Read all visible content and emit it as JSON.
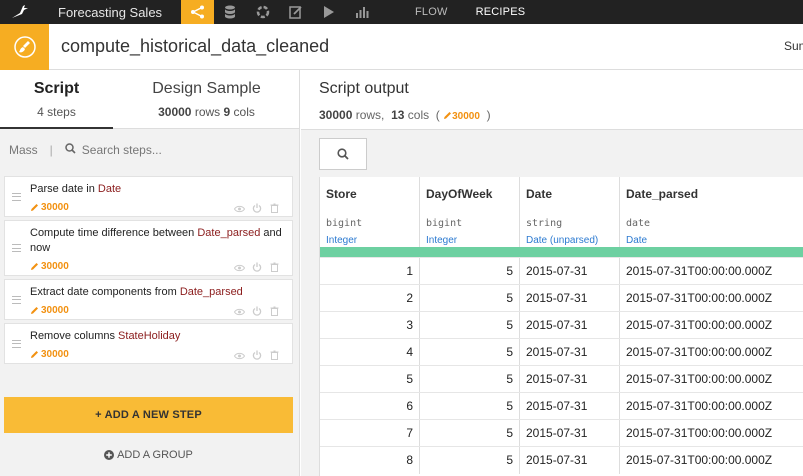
{
  "nav": {
    "project": "Forecasting Sales",
    "links": [
      "FLOW",
      "RECIPES"
    ]
  },
  "header": {
    "title": "compute_historical_data_cleaned",
    "right_text": "Sum"
  },
  "left": {
    "tabs": {
      "script": {
        "label": "Script",
        "sub_count": "4",
        "sub_label": "steps"
      },
      "design": {
        "label": "Design Sample",
        "rows": "30000",
        "rows_label": "rows",
        "cols": "9",
        "cols_label": "cols"
      }
    },
    "search": {
      "mass": "Mass",
      "placeholder": "Search steps..."
    },
    "steps": [
      {
        "text": "Parse date",
        "connector": "in",
        "column": "Date",
        "tail": "",
        "count": "30000"
      },
      {
        "text": "Compute time difference",
        "connector": "between",
        "column": "Date_parsed",
        "tail": "and now",
        "count": "30000"
      },
      {
        "text": "Extract date components",
        "connector": "from",
        "column": "Date_parsed",
        "tail": "",
        "count": "30000"
      },
      {
        "text": "Remove columns",
        "connector": "",
        "column": "StateHoliday",
        "tail": "",
        "count": "30000"
      }
    ],
    "add_step": "+ ADD A NEW STEP",
    "add_group": "ADD A GROUP"
  },
  "right": {
    "title": "Script output",
    "rows": "30000",
    "rows_label": "rows,",
    "cols": "13",
    "cols_label": "cols",
    "paren_open": "(",
    "badge": "30000",
    "paren_close": ")"
  },
  "table": {
    "columns": [
      {
        "name": "Store",
        "type": "bigint",
        "meaning": "Integer"
      },
      {
        "name": "DayOfWeek",
        "type": "bigint",
        "meaning": "Integer"
      },
      {
        "name": "Date",
        "type": "string",
        "meaning": "Date (unparsed)"
      },
      {
        "name": "Date_parsed",
        "type": "date",
        "meaning": "Date"
      }
    ],
    "rows": [
      [
        "1",
        "5",
        "2015-07-31",
        "2015-07-31T00:00:00.000Z"
      ],
      [
        "2",
        "5",
        "2015-07-31",
        "2015-07-31T00:00:00.000Z"
      ],
      [
        "3",
        "5",
        "2015-07-31",
        "2015-07-31T00:00:00.000Z"
      ],
      [
        "4",
        "5",
        "2015-07-31",
        "2015-07-31T00:00:00.000Z"
      ],
      [
        "5",
        "5",
        "2015-07-31",
        "2015-07-31T00:00:00.000Z"
      ],
      [
        "6",
        "5",
        "2015-07-31",
        "2015-07-31T00:00:00.000Z"
      ],
      [
        "7",
        "5",
        "2015-07-31",
        "2015-07-31T00:00:00.000Z"
      ],
      [
        "8",
        "5",
        "2015-07-31",
        "2015-07-31T00:00:00.000Z"
      ]
    ]
  },
  "colors": {
    "accent": "#f6ad22",
    "add_step": "#f9bb36",
    "meaning_band": "#6dd0a1",
    "meaning_text": "#2d7bd1",
    "column_ref": "#8b1c1c",
    "count": "#f29111"
  }
}
